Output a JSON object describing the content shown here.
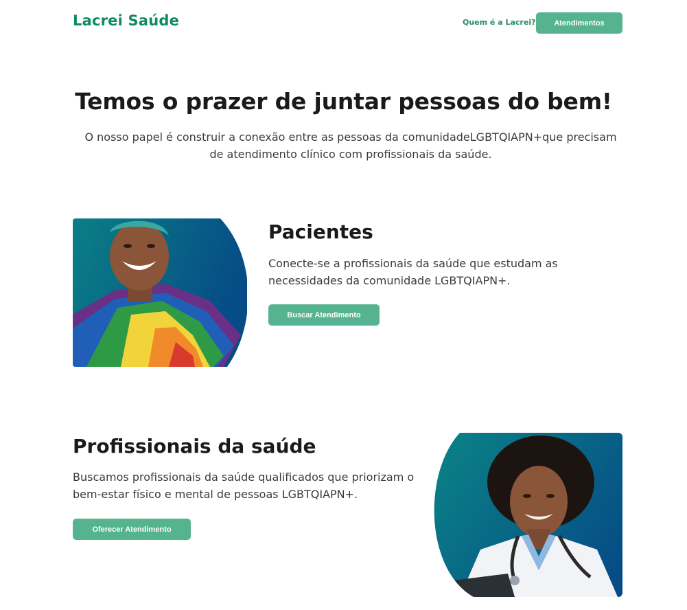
{
  "header": {
    "logo": "Lacrei Saúde",
    "nav_link": "Quem é a Lacrei?",
    "nav_button": "Atendimentos"
  },
  "hero": {
    "title": "Temos o prazer de juntar pessoas do bem!",
    "subtitle": "O nosso papel é construir a conexão entre as pessoas da comunidadeLGBTQIAPN+que precisam de atendimento clínico com profissionais da saúde."
  },
  "patients": {
    "title": "Pacientes",
    "text": "Conecte-se a profissionais da saúde que estudam as necessidades da comunidade LGBTQIAPN+.",
    "button": "Buscar Atendimento"
  },
  "professionals": {
    "title": "Profissionais da saúde",
    "text": "Buscamos profissionais da saúde qualificados que priorizam o bem-estar físico e mental de pessoas LGBTQIAPN+.",
    "button": "Oferecer Atendimento"
  },
  "colors": {
    "brand": "#0e8a5f",
    "button": "#56b38f",
    "image_gradient_start": "#0a7f86",
    "image_gradient_end": "#064c86"
  }
}
